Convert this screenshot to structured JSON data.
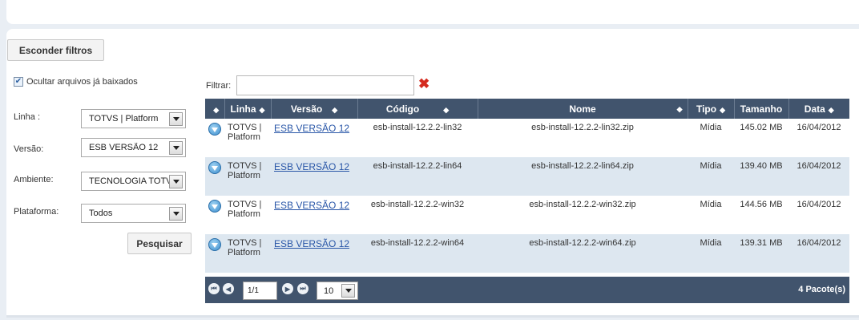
{
  "toolbar": {
    "hide_filters_label": "Esconder filtros"
  },
  "filters": {
    "hide_downloaded": {
      "label": "Ocultar arquivos já baixados",
      "checked": true
    },
    "fields": [
      {
        "label": "Linha :",
        "value": "TOTVS | Platform"
      },
      {
        "label": "Versão:",
        "value": "ESB VERSÃO 12"
      },
      {
        "label": "Ambiente:",
        "value": "TECNOLOGIA TOTVS"
      },
      {
        "label": "Plataforma:",
        "value": "Todos"
      }
    ],
    "search_label": "Pesquisar"
  },
  "table": {
    "filter_label": "Filtrar:",
    "filter_value": "",
    "columns": [
      "",
      "Linha",
      "Versão",
      "Código",
      "Nome",
      "Tipo",
      "Tamanho",
      "Data"
    ],
    "rows": [
      {
        "linha": "TOTVS | Platform",
        "versao": "ESB VERSÃO 12",
        "codigo": "esb-install-12.2.2-lin32",
        "nome": "esb-install-12.2.2-lin32.zip",
        "tipo": "Mídia",
        "tamanho": "145.02 MB",
        "data": "16/04/2012"
      },
      {
        "linha": "TOTVS | Platform",
        "versao": "ESB VERSÃO 12",
        "codigo": "esb-install-12.2.2-lin64",
        "nome": "esb-install-12.2.2-lin64.zip",
        "tipo": "Mídia",
        "tamanho": "139.40 MB",
        "data": "16/04/2012"
      },
      {
        "linha": "TOTVS | Platform",
        "versao": "ESB VERSÃO 12",
        "codigo": "esb-install-12.2.2-win32",
        "nome": "esb-install-12.2.2-win32.zip",
        "tipo": "Mídia",
        "tamanho": "144.56 MB",
        "data": "16/04/2012"
      },
      {
        "linha": "TOTVS | Platform",
        "versao": "ESB VERSÃO 12",
        "codigo": "esb-install-12.2.2-win64",
        "nome": "esb-install-12.2.2-win64.zip",
        "tipo": "Mídia",
        "tamanho": "139.31 MB",
        "data": "16/04/2012"
      }
    ]
  },
  "pager": {
    "page": "1/1",
    "per_page": "10",
    "total_label": "4 Pacote(s)"
  },
  "colors": {
    "header_bg": "#41546d",
    "row_alt": "#dde7f0",
    "link": "#2a57a8",
    "clear_icon": "#d42a1e"
  },
  "icons": {
    "download": "download-icon",
    "clear": "clear-filter-icon",
    "sort": "sort-icon"
  }
}
